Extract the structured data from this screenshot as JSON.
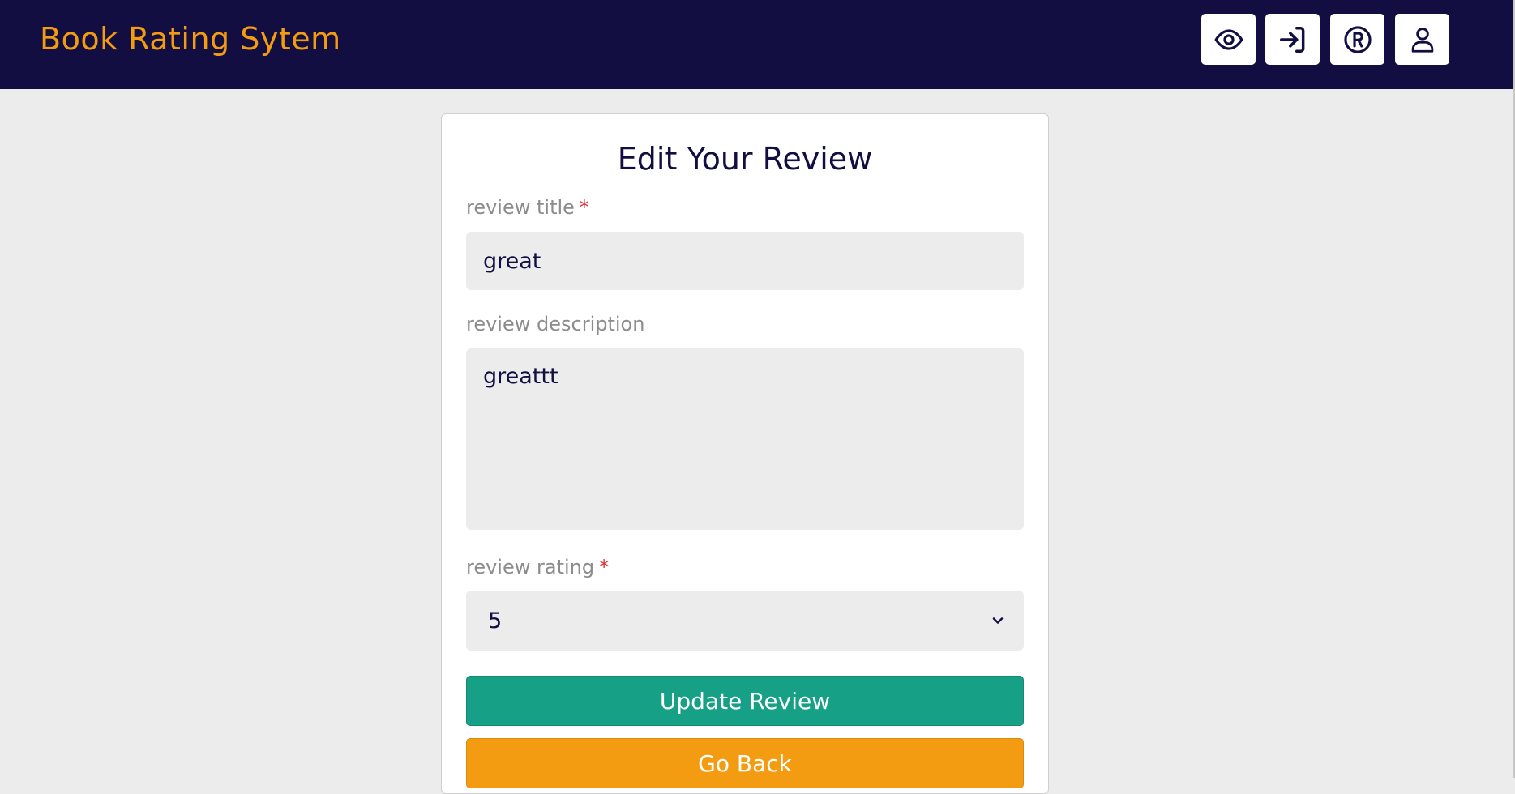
{
  "app": {
    "brand": "Book Rating Sytem"
  },
  "nav": {
    "buttons": [
      {
        "icon": "eye-icon"
      },
      {
        "icon": "login-icon"
      },
      {
        "icon": "registered-icon"
      },
      {
        "icon": "user-icon"
      }
    ]
  },
  "form": {
    "heading": "Edit Your Review",
    "title_label": "review title",
    "title_value": "great",
    "description_label": "review description",
    "description_value": "greattt",
    "rating_label": "review rating",
    "rating_value": "5",
    "required_mark": "*",
    "update_button": "Update Review",
    "back_button": "Go Back"
  },
  "colors": {
    "navbar": "#120e42",
    "brand": "#f39c12",
    "update_button": "#16a085",
    "back_button": "#f39c12",
    "required": "#e03131"
  }
}
